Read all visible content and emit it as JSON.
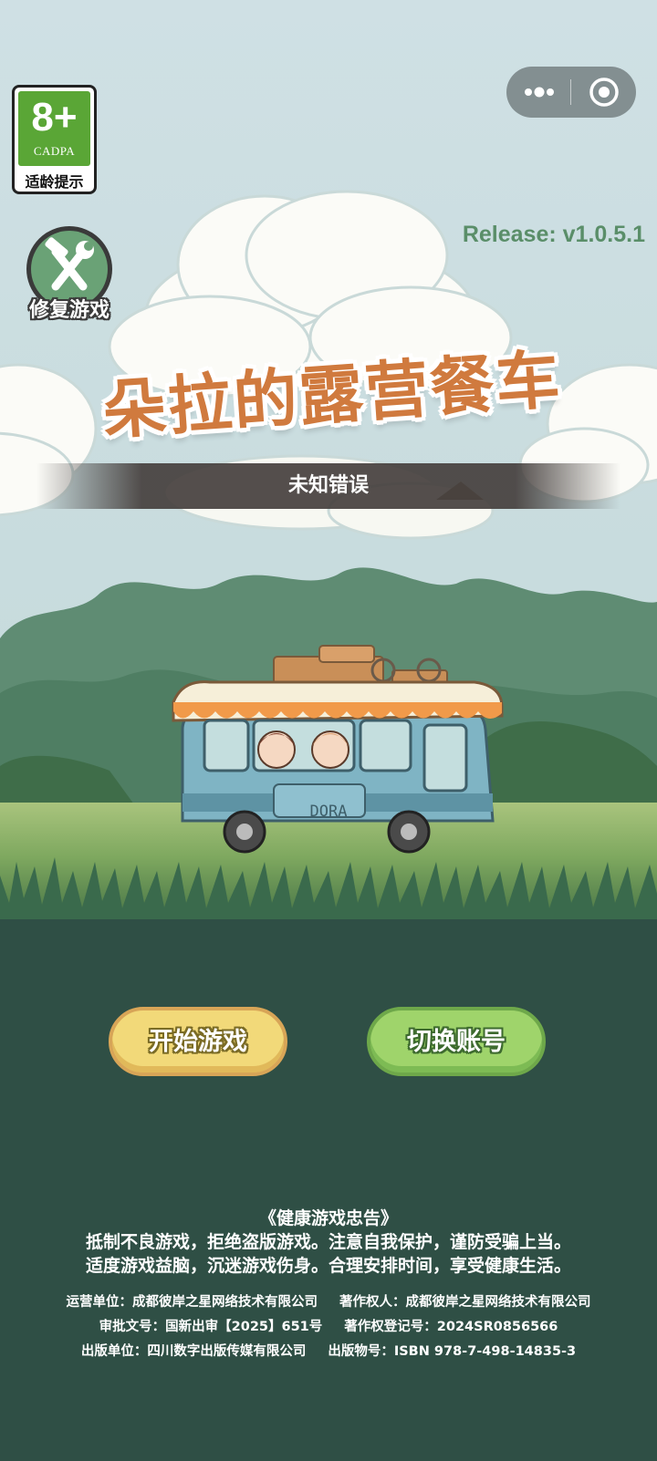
{
  "age_rating": {
    "number": "8+",
    "org": "CADPA",
    "label": "适龄提示"
  },
  "capsule": {
    "more_icon": "more-dots-icon",
    "close_icon": "target-close-icon"
  },
  "repair": {
    "label": "修复游戏",
    "icon": "wrench-hammer-icon"
  },
  "release": "Release: v1.0.5.1",
  "title": "朵拉的露营餐车",
  "bus_plate": "DORA",
  "error_message": "未知错误",
  "buttons": {
    "start": "开始游戏",
    "switch": "切换账号"
  },
  "footer": {
    "notice_title": "《健康游戏忠告》",
    "notice_line1": "抵制不良游戏，拒绝盗版游戏。注意自我保护，谨防受骗上当。",
    "notice_line2": "适度游戏益脑，沉迷游戏伤身。合理安排时间，享受健康生活。",
    "operator": "运营单位：成都彼岸之星网络技术有限公司",
    "copyright_holder": "著作权人：成都彼岸之星网络技术有限公司",
    "approval": "审批文号：国新出审【2025】651号",
    "copyright_reg": "著作权登记号：2024SR0856566",
    "publisher": "出版单位：四川数字出版传媒有限公司",
    "isbn": "出版物号：ISBN 978-7-498-14835-3"
  },
  "colors": {
    "sky": "#cfe2e6",
    "grass_dark": "#2f4f45",
    "release_text": "#5a8e69",
    "title": "#d07a3e",
    "start_button": "#f2d979",
    "switch_button": "#9fd46b"
  }
}
